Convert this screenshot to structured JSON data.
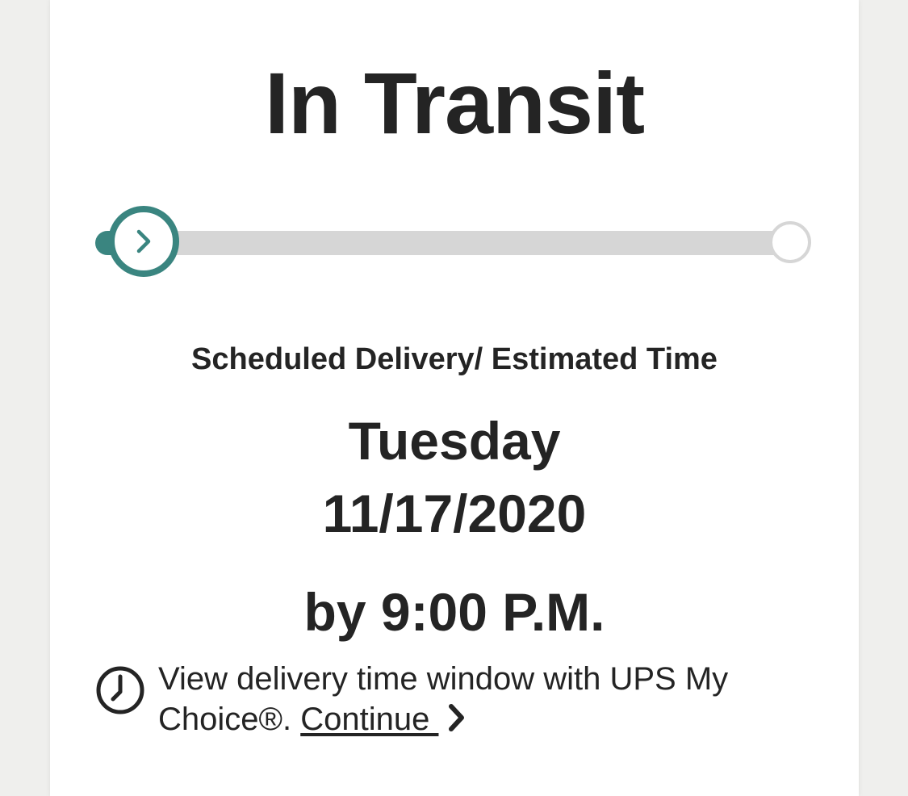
{
  "status": {
    "title": "In Transit"
  },
  "progress": {
    "fraction": 0.0,
    "accent_color": "#3a8580",
    "track_color": "#d6d6d6",
    "start_icon": "chevron-right-icon"
  },
  "delivery": {
    "label": "Scheduled Delivery/ Estimated Time",
    "day": "Tuesday",
    "date": "11/17/2020",
    "time": "by 9:00 P.M."
  },
  "info": {
    "icon": "clock-icon",
    "text": "View delivery time window with UPS My Choice®. ",
    "link_label": "Continue ",
    "link_icon": "chevron-right-icon"
  }
}
